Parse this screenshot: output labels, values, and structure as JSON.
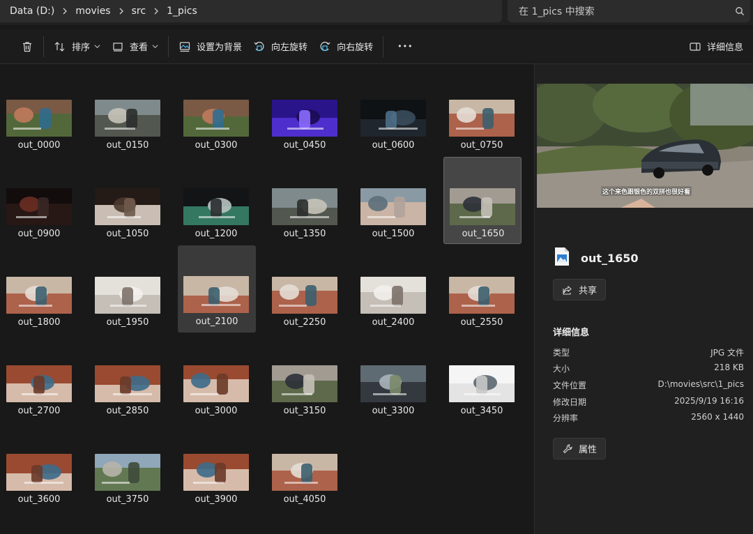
{
  "breadcrumb": [
    "Data (D:)",
    "movies",
    "src",
    "1_pics"
  ],
  "search": {
    "placeholder": "在 1_pics 中搜索",
    "icon": "search-icon"
  },
  "toolbar": {
    "sort_label": "排序",
    "view_label": "查看",
    "set_background_label": "设置为背景",
    "rotate_left_label": "向左旋转",
    "rotate_right_label": "向右旋转",
    "more_label": "•••",
    "details_label": "详细信息"
  },
  "files": [
    {
      "name": "out_0000",
      "scene": "garden"
    },
    {
      "name": "out_0150",
      "scene": "outdoor"
    },
    {
      "name": "out_0300",
      "scene": "garden"
    },
    {
      "name": "out_0450",
      "scene": "purple"
    },
    {
      "name": "out_0600",
      "scene": "night"
    },
    {
      "name": "out_0750",
      "scene": "cabin"
    },
    {
      "name": "out_0900",
      "scene": "dark"
    },
    {
      "name": "out_1050",
      "scene": "seat-dark"
    },
    {
      "name": "out_1200",
      "scene": "screen"
    },
    {
      "name": "out_1350",
      "scene": "outdoor"
    },
    {
      "name": "out_1500",
      "scene": "hands"
    },
    {
      "name": "out_1650",
      "scene": "car-outdoor",
      "state": "selected"
    },
    {
      "name": "out_1800",
      "scene": "cabin"
    },
    {
      "name": "out_1950",
      "scene": "white-cabin"
    },
    {
      "name": "out_2100",
      "scene": "cabin",
      "state": "hover"
    },
    {
      "name": "out_2250",
      "scene": "cabin"
    },
    {
      "name": "out_2400",
      "scene": "white-cabin"
    },
    {
      "name": "out_2550",
      "scene": "cabin"
    },
    {
      "name": "out_2700",
      "scene": "console"
    },
    {
      "name": "out_2850",
      "scene": "console"
    },
    {
      "name": "out_3000",
      "scene": "console"
    },
    {
      "name": "out_3150",
      "scene": "car-outdoor"
    },
    {
      "name": "out_3300",
      "scene": "car-close"
    },
    {
      "name": "out_3450",
      "scene": "white"
    },
    {
      "name": "out_3600",
      "scene": "console"
    },
    {
      "name": "out_3750",
      "scene": "road"
    },
    {
      "name": "out_3900",
      "scene": "console"
    },
    {
      "name": "out_4050",
      "scene": "cabin"
    }
  ],
  "details": {
    "file_name": "out_1650",
    "share_label": "共享",
    "section_title": "详细信息",
    "properties": [
      {
        "key": "类型",
        "value": "JPG 文件"
      },
      {
        "key": "大小",
        "value": "218 KB"
      },
      {
        "key": "文件位置",
        "value": "D:\\movies\\src\\1_pics"
      },
      {
        "key": "修改日期",
        "value": "2025/9/19 16:16"
      },
      {
        "key": "分辨率",
        "value": "2560 x 1440"
      }
    ],
    "properties_button_label": "属性",
    "preview_caption": "这个来色跟银色的双拼也很好看"
  }
}
